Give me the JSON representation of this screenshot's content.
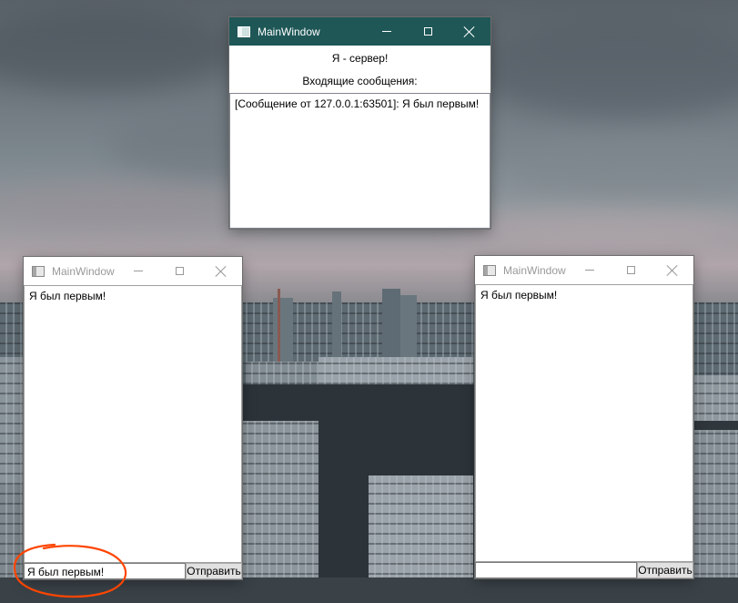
{
  "server_window": {
    "title": "MainWindow",
    "heading": "Я - сервер!",
    "incoming_label": "Входящие сообщения:",
    "messages": [
      "[Сообщение от 127.0.0.1:63501]: Я был первым!"
    ]
  },
  "client_window_left": {
    "title": "MainWindow",
    "log_text": "Я был первым!",
    "input_value": "Я был первым!",
    "send_label": "Отправить"
  },
  "client_window_right": {
    "title": "MainWindow",
    "log_text": "Я был первым!",
    "input_value": "",
    "send_label": "Отправить"
  },
  "colors": {
    "active_titlebar": "#1f5757",
    "annotation_circle": "#ff4500"
  },
  "icons": [
    "app-icon",
    "minimize-icon",
    "maximize-icon",
    "close-icon"
  ]
}
